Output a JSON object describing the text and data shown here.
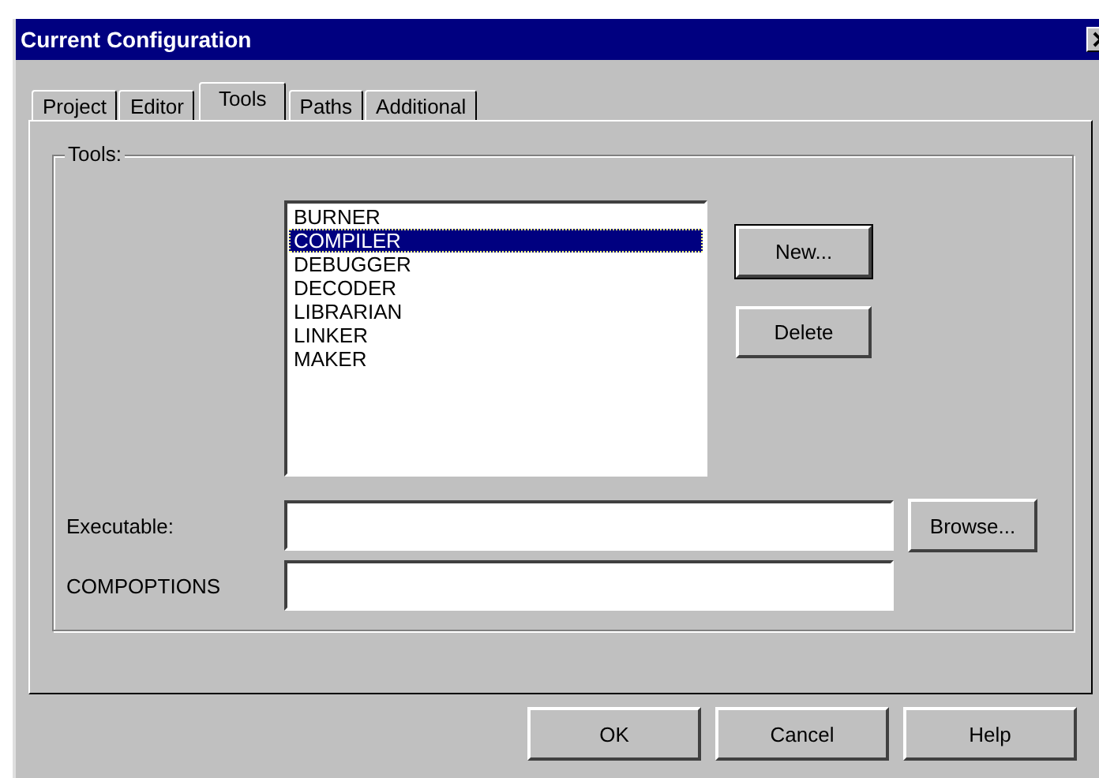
{
  "window": {
    "title": "Current Configuration"
  },
  "tabs": [
    {
      "label": "Project",
      "selected": false
    },
    {
      "label": "Editor",
      "selected": false
    },
    {
      "label": "Tools",
      "selected": true
    },
    {
      "label": "Paths",
      "selected": false
    },
    {
      "label": "Additional",
      "selected": false
    }
  ],
  "group": {
    "title": "Tools:"
  },
  "tools_list": [
    {
      "label": "BURNER",
      "selected": false
    },
    {
      "label": "COMPILER",
      "selected": true
    },
    {
      "label": "DEBUGGER",
      "selected": false
    },
    {
      "label": "DECODER",
      "selected": false
    },
    {
      "label": "LIBRARIAN",
      "selected": false
    },
    {
      "label": "LINKER",
      "selected": false
    },
    {
      "label": "MAKER",
      "selected": false
    }
  ],
  "list_buttons": [
    "New...",
    "Delete"
  ],
  "fields": [
    {
      "label": "Executable:",
      "button": "Browse..."
    },
    {
      "label": "COMPOPTIONS"
    }
  ],
  "buttons": [
    "OK",
    "Cancel",
    "Help"
  ]
}
